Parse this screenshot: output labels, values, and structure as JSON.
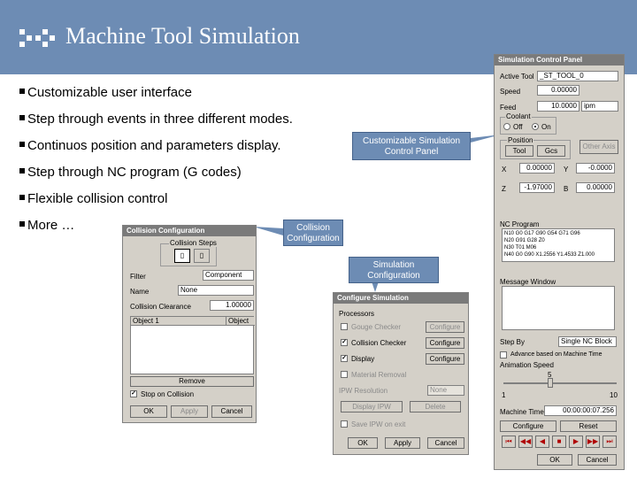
{
  "slide": {
    "title": "Machine Tool Simulation",
    "bullets": [
      "Customizable user interface",
      "Step through events in three different modes.",
      "Continuos position and parameters display.",
      "Step through NC program (G codes)",
      "Flexible collision control",
      "More …"
    ],
    "callouts": {
      "control_panel": "Customizable Simulation Control Panel",
      "collision": "Collision Configuration",
      "simulation": "Simulation Configuration"
    }
  },
  "control_panel": {
    "title": "Simulation Control Panel",
    "active_tool_label": "Active Tool",
    "active_tool_value": "_ST_TOOL_0",
    "speed_label": "Speed",
    "speed_value": "0.00000",
    "feed_label": "Feed",
    "feed_value": "10.0000",
    "feed_unit": "ipm",
    "coolant_label": "Coolant",
    "coolant_off": "Off",
    "coolant_on": "On",
    "position_label": "Position",
    "pos_tool": "Tool",
    "pos_gcs": "Gcs",
    "other_axis": "Other Axis",
    "coords": [
      {
        "axis": "X",
        "value": "0.00000"
      },
      {
        "axis": "Y",
        "value": "-0.0000"
      },
      {
        "axis": "Z",
        "value": "-1.97000"
      },
      {
        "axis": "B",
        "value": "0.00000"
      }
    ],
    "nc_program_label": "NC Program",
    "nc_lines": [
      "N10 G0 G17 G90 G54 G71 G96",
      "N20 G91 G28 Z0",
      "N30 T01 M06",
      "N40 G0 G90 X1.2556 Y1.4533 Z1.000"
    ],
    "message_window_label": "Message Window",
    "step_by_label": "Step By",
    "step_by_value": "Single NC Block",
    "advance_realtime": "Advance based on Machine Time",
    "animation_speed_label": "Animation Speed",
    "animation_speed_value": "5",
    "slider_min": "1",
    "slider_max": "10",
    "machine_time_label": "Machine Time",
    "machine_time_value": "00:00:00:07.256",
    "configure": "Configure",
    "reset": "Reset",
    "ok": "OK",
    "cancel": "Cancel"
  },
  "collision_config": {
    "title": "Collision Configuration",
    "collision_steps_label": "Collision Steps",
    "filter_label": "Filter",
    "filter_value": "Component",
    "name_label": "Name",
    "name_value": "None",
    "clearance_label": "Collision Clearance",
    "clearance_value": "1.00000",
    "col_object1": "Object 1",
    "col_object2": "Object",
    "remove": "Remove",
    "stop_on_collision": "Stop on Collision",
    "ok": "OK",
    "apply": "Apply",
    "cancel": "Cancel"
  },
  "sim_config": {
    "title": "Configure Simulation",
    "processors_label": "Processors",
    "gouge_checker": "Gouge Checker",
    "collision_checker": "Collision Checker",
    "display": "Display",
    "material_removal": "Material Removal",
    "ipw_resolution_label": "IPW Resolution",
    "ipw_resolution_value": "None",
    "display_ipw": "Display IPW",
    "delete": "Delete",
    "save_ipw": "Save IPW on exit",
    "configure": "Configure",
    "ok": "OK",
    "apply": "Apply",
    "cancel": "Cancel"
  },
  "colors": {
    "header": "#6d8cb4",
    "callout": "#6d8cb4",
    "window": "#d4d0c8",
    "titlebar": "#7a7a7a",
    "media_icons": "#b00000"
  }
}
